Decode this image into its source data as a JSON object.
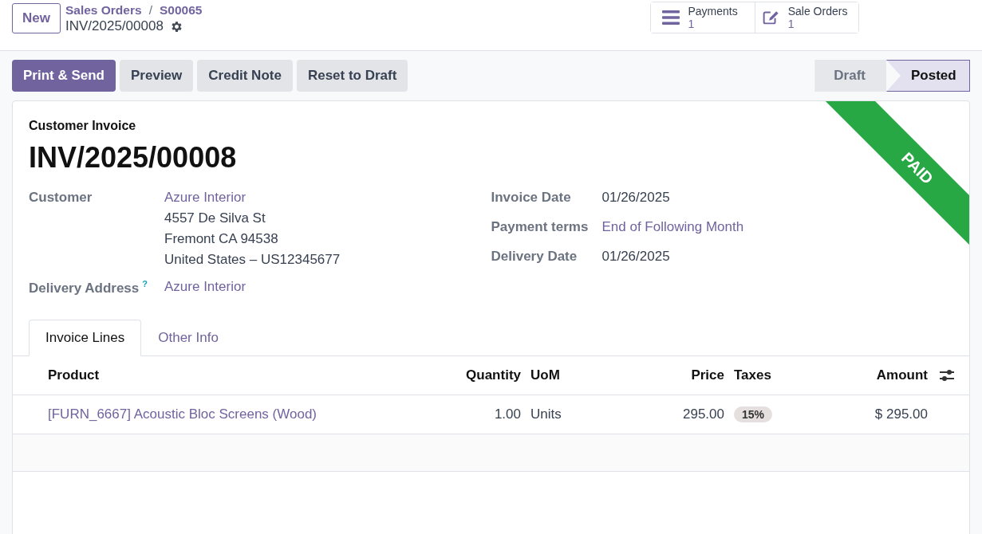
{
  "top_bar": {
    "new_button": "New",
    "breadcrumbs": [
      {
        "label": "Sales Orders"
      },
      {
        "label": "S00065"
      }
    ],
    "breadcrumb_separator": "/",
    "record_title": "INV/2025/00008",
    "smart_buttons": [
      {
        "label": "Payments",
        "count": "1"
      },
      {
        "label": "Sale Orders",
        "count": "1"
      }
    ]
  },
  "actions": [
    {
      "label": "Print & Send",
      "primary": true
    },
    {
      "label": "Preview",
      "primary": false
    },
    {
      "label": "Credit Note",
      "primary": false
    },
    {
      "label": "Reset to Draft",
      "primary": false
    }
  ],
  "status_bar": [
    {
      "label": "Draft",
      "selected": false
    },
    {
      "label": "Posted",
      "selected": true
    }
  ],
  "sheet": {
    "ribbon": "PAID",
    "doc_type": "Customer Invoice",
    "doc_number": "INV/2025/00008",
    "left_fields": [
      {
        "label": "Customer",
        "value": "Azure Interior",
        "kind": "link",
        "extra_lines": [
          "4557 De Silva St",
          "Fremont CA 94538",
          "United States – US12345677"
        ]
      },
      {
        "label": "Delivery Address",
        "help": "?",
        "value": "Azure Interior",
        "kind": "link"
      }
    ],
    "right_fields": [
      {
        "label": "Invoice Date",
        "value": "01/26/2025",
        "kind": "text"
      },
      {
        "label": "Payment terms",
        "value": "End of Following Month",
        "kind": "link"
      },
      {
        "label": "Delivery Date",
        "value": "01/26/2025",
        "kind": "text"
      }
    ],
    "tabs": [
      {
        "label": "Invoice Lines",
        "selected": true
      },
      {
        "label": "Other Info",
        "selected": false
      }
    ],
    "table": {
      "columns": [
        {
          "label": "Product"
        },
        {
          "label": "Quantity"
        },
        {
          "label": "UoM"
        },
        {
          "label": "Price"
        },
        {
          "label": "Taxes"
        },
        {
          "label": "Amount"
        }
      ],
      "rows": [
        {
          "product": "[FURN_6667] Acoustic Bloc Screens (Wood)",
          "quantity": "1.00",
          "uom": "Units",
          "price": "295.00",
          "taxes": [
            "15%"
          ],
          "amount": "$ 295.00"
        }
      ]
    }
  }
}
